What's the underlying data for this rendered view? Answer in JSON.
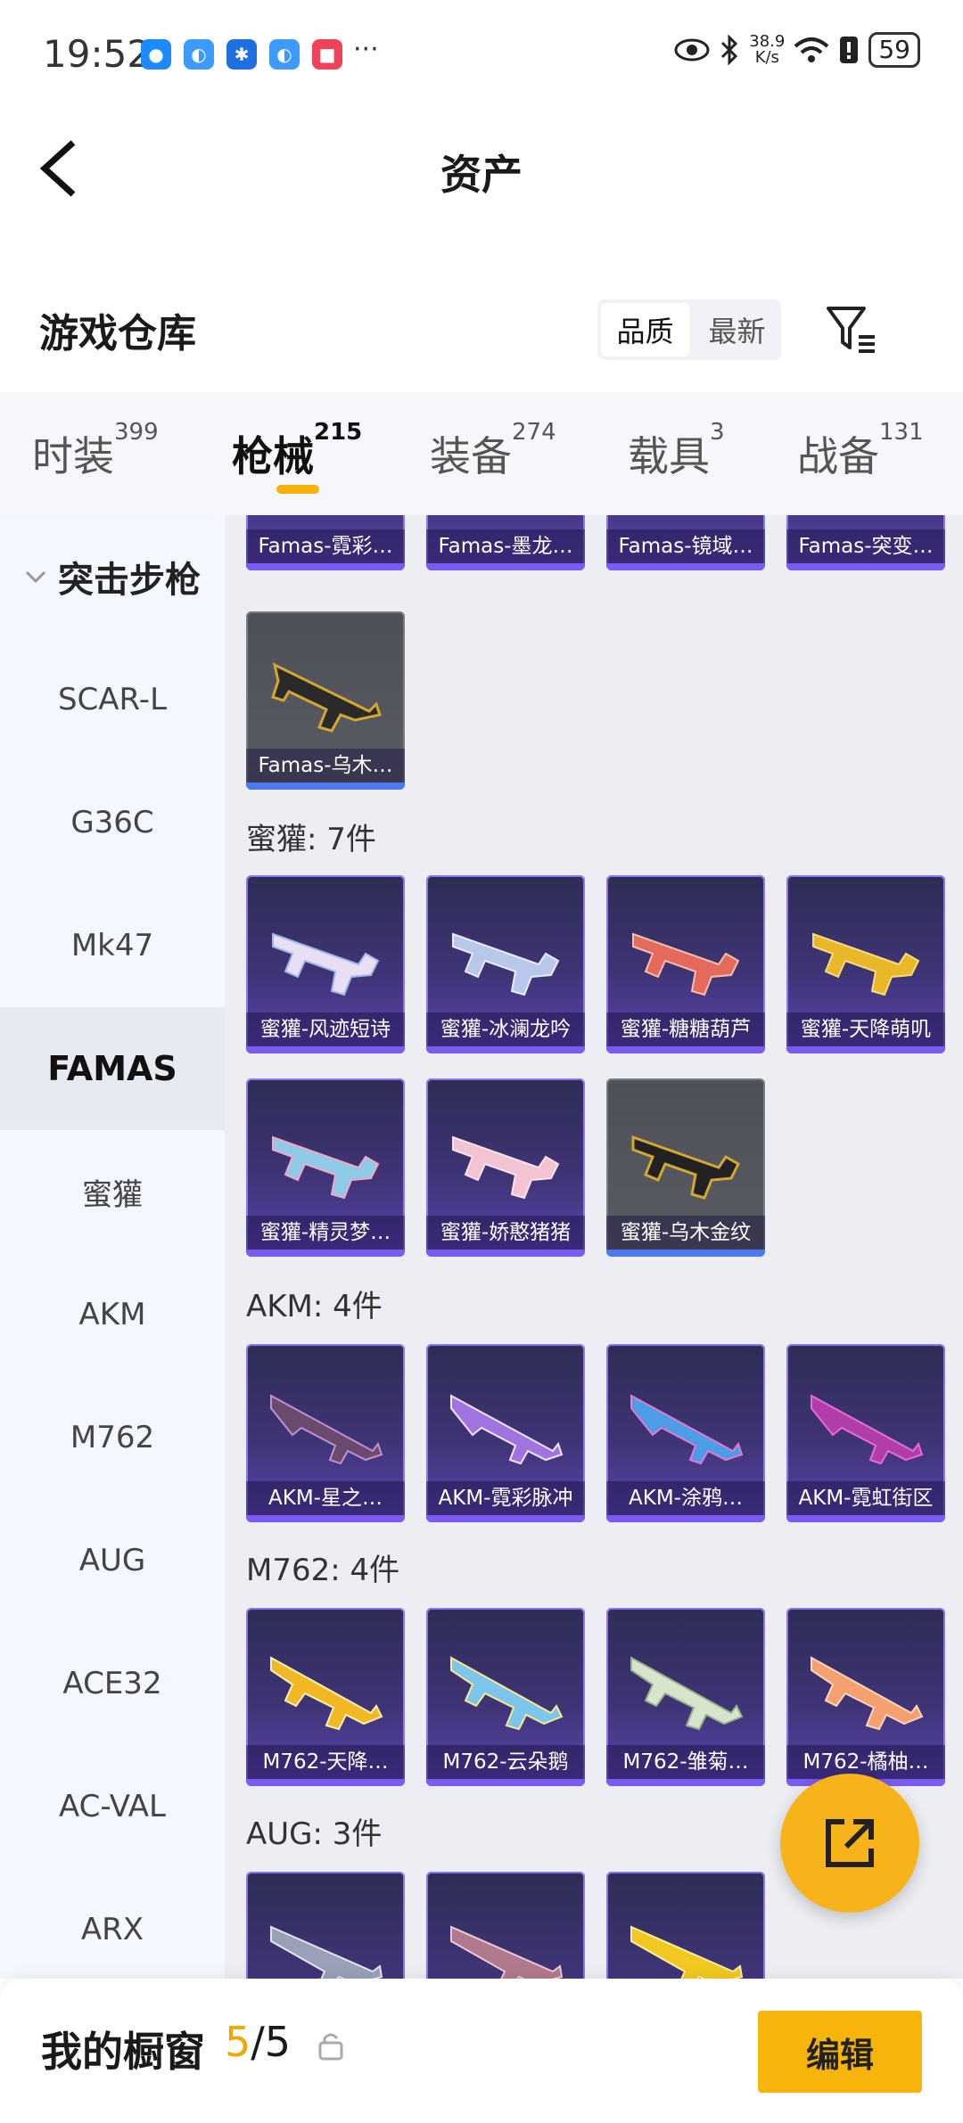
{
  "status_bar": {
    "time": "19:52",
    "speed_top": "38.9",
    "speed_bottom": "K/s",
    "battery": "59",
    "more": "···"
  },
  "header": {
    "title": "资产"
  },
  "warehouse": {
    "title": "游戏仓库",
    "sort_options": [
      "品质",
      "最新"
    ],
    "active_sort": "品质"
  },
  "tabs": [
    {
      "label": "时装",
      "count": "399"
    },
    {
      "label": "枪械",
      "count": "215"
    },
    {
      "label": "装备",
      "count": "274"
    },
    {
      "label": "载具",
      "count": "3"
    },
    {
      "label": "战备",
      "count": "131"
    }
  ],
  "sidebar": {
    "group": "突击步枪",
    "items": [
      "SCAR-L",
      "G36C",
      "Mk47",
      "FAMAS",
      "蜜獾",
      "AKM",
      "M762",
      "AUG",
      "ACE32",
      "AC-VAL",
      "ARX"
    ],
    "active": "FAMAS"
  },
  "sections": {
    "famas_top": [
      "Famas-霓彩…",
      "Famas-墨龙…",
      "Famas-镜域…",
      "Famas-突变…"
    ],
    "famas_more": [
      "Famas-乌木…"
    ],
    "miguan_title": "蜜獾: 7件",
    "miguan": [
      "蜜獾-风迹短诗",
      "蜜獾-冰澜龙吟",
      "蜜獾-糖糖葫芦",
      "蜜獾-天降萌叽",
      "蜜獾-精灵梦…",
      "蜜獾-娇憨猪猪",
      "蜜獾-乌木金纹"
    ],
    "akm_title": "AKM: 4件",
    "akm": [
      "AKM-星之…",
      "AKM-霓彩脉冲",
      "AKM-涂鸦…",
      "AKM-霓虹街区"
    ],
    "m762_title": "M762: 4件",
    "m762": [
      "M762-天降…",
      "M762-云朵鹅",
      "M762-雏菊…",
      "M762-橘柚…"
    ],
    "aug_title": "AUG: 3件"
  },
  "bottom": {
    "label": "我的橱窗",
    "current": "5",
    "sep": "/",
    "total": "5",
    "edit": "编辑"
  },
  "colors": {
    "accent": "#f7b50c",
    "card_purple": "#3f3476",
    "card_gray": "#55575f"
  }
}
